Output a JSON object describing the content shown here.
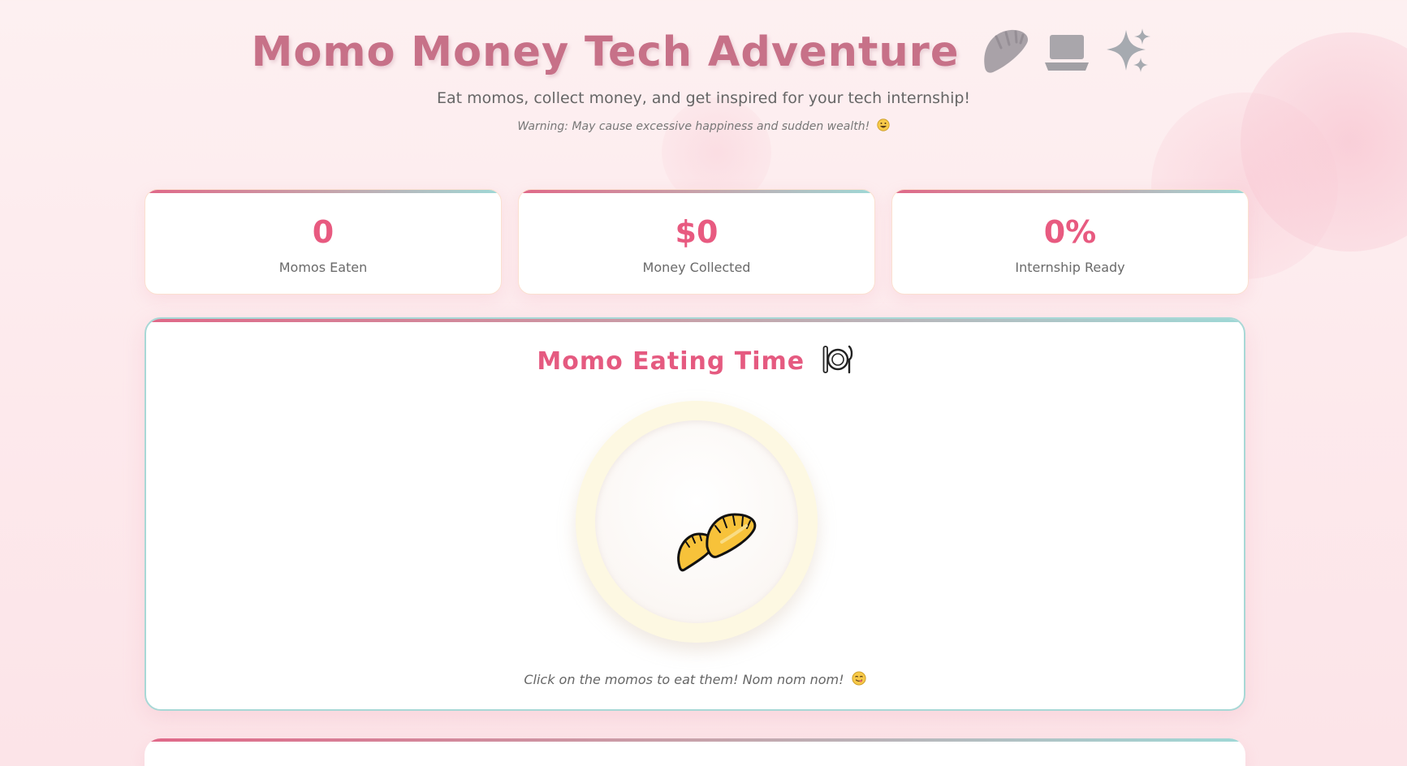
{
  "header": {
    "title": "Momo Money Tech Adventure",
    "title_icons": [
      "dumpling-icon",
      "laptop-icon",
      "sparkle-icon"
    ],
    "subtitle": "Eat momos, collect money, and get inspired for your tech internship!",
    "warning": "Warning: May cause excessive happiness and sudden wealth!",
    "warning_icon": "grinning-face-icon"
  },
  "stats": [
    {
      "value": "0",
      "label": "Momos Eaten"
    },
    {
      "value": "$0",
      "label": "Money Collected"
    },
    {
      "value": "0%",
      "label": "Internship Ready"
    }
  ],
  "eating_panel": {
    "title": "Momo Eating Time",
    "title_icon": "fork-knife-plate-icon",
    "plate_icon": "dumpling-icon",
    "hint": "Click on the momos to eat them! Nom nom nom!",
    "hint_icon": "yum-face-icon"
  },
  "colors": {
    "accent_pink": "#e85a80",
    "title_pink": "#c77188",
    "teal_border": "#a8d8d6",
    "plate_rim": "#fdf8e2"
  }
}
